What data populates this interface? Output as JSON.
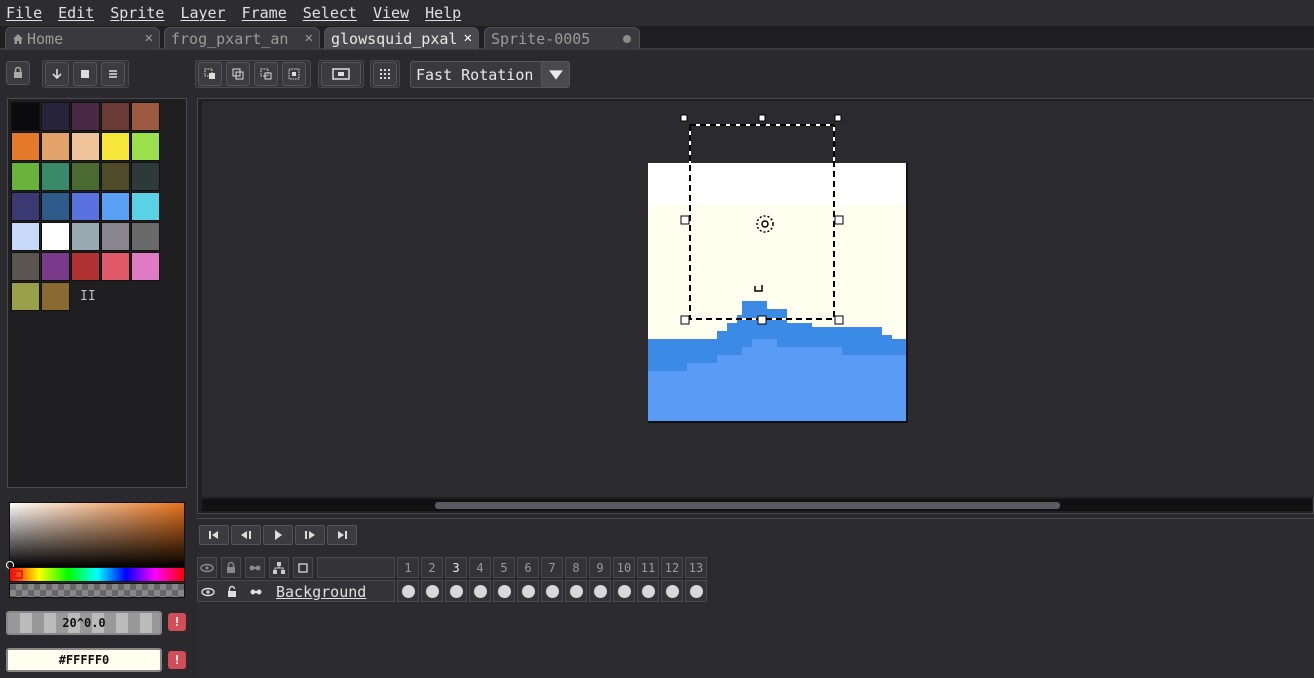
{
  "menu": {
    "file": "File",
    "edit": "Edit",
    "sprite": "Sprite",
    "layer": "Layer",
    "frame": "Frame",
    "select": "Select",
    "view": "View",
    "help": "Help"
  },
  "tabs": [
    {
      "label": "Home"
    },
    {
      "label": "frog_pxart_an"
    },
    {
      "label": "glowsquid_pxal"
    },
    {
      "label": "Sprite-0005"
    }
  ],
  "toolbar": {
    "rotation_mode": "Fast Rotation"
  },
  "palette": {
    "colors": [
      "#0b0b0d",
      "#26233a",
      "#4a2945",
      "#6a3a37",
      "#9c5a40",
      "#e47a2a",
      "#e2a36a",
      "#f0c49a",
      "#f5e638",
      "#9ae04c",
      "#6ab33a",
      "#3a8a6a",
      "#4a6a32",
      "#4e4a2a",
      "#2e3a3a",
      "#3a3a72",
      "#2e5a8a",
      "#5a72e0",
      "#5aa0f5",
      "#5ad2e6",
      "#c8d8f8",
      "#ffffff",
      "#9aaab2",
      "#8a8690",
      "#6a6a6a",
      "#5a5550",
      "#7a3a8a",
      "#b03232",
      "#e05a6a",
      "#e07ac4",
      "#9aa04a",
      "#8a6a32"
    ],
    "more_indicator": "II"
  },
  "color_picker": {
    "foreground_value": "20^0.0",
    "background_value": "#FFFFF0",
    "warn_label": "!"
  },
  "timeline": {
    "frames": [
      "1",
      "2",
      "3",
      "4",
      "5",
      "6",
      "7",
      "8",
      "9",
      "10",
      "11",
      "12",
      "13"
    ],
    "current_frame": "3",
    "layer_name": "Background"
  },
  "canvas": {
    "background_color": "#ffffff",
    "sky_color": "#fffff0",
    "water_dark": "#3a8ae6",
    "water_light": "#5a9cf5"
  }
}
